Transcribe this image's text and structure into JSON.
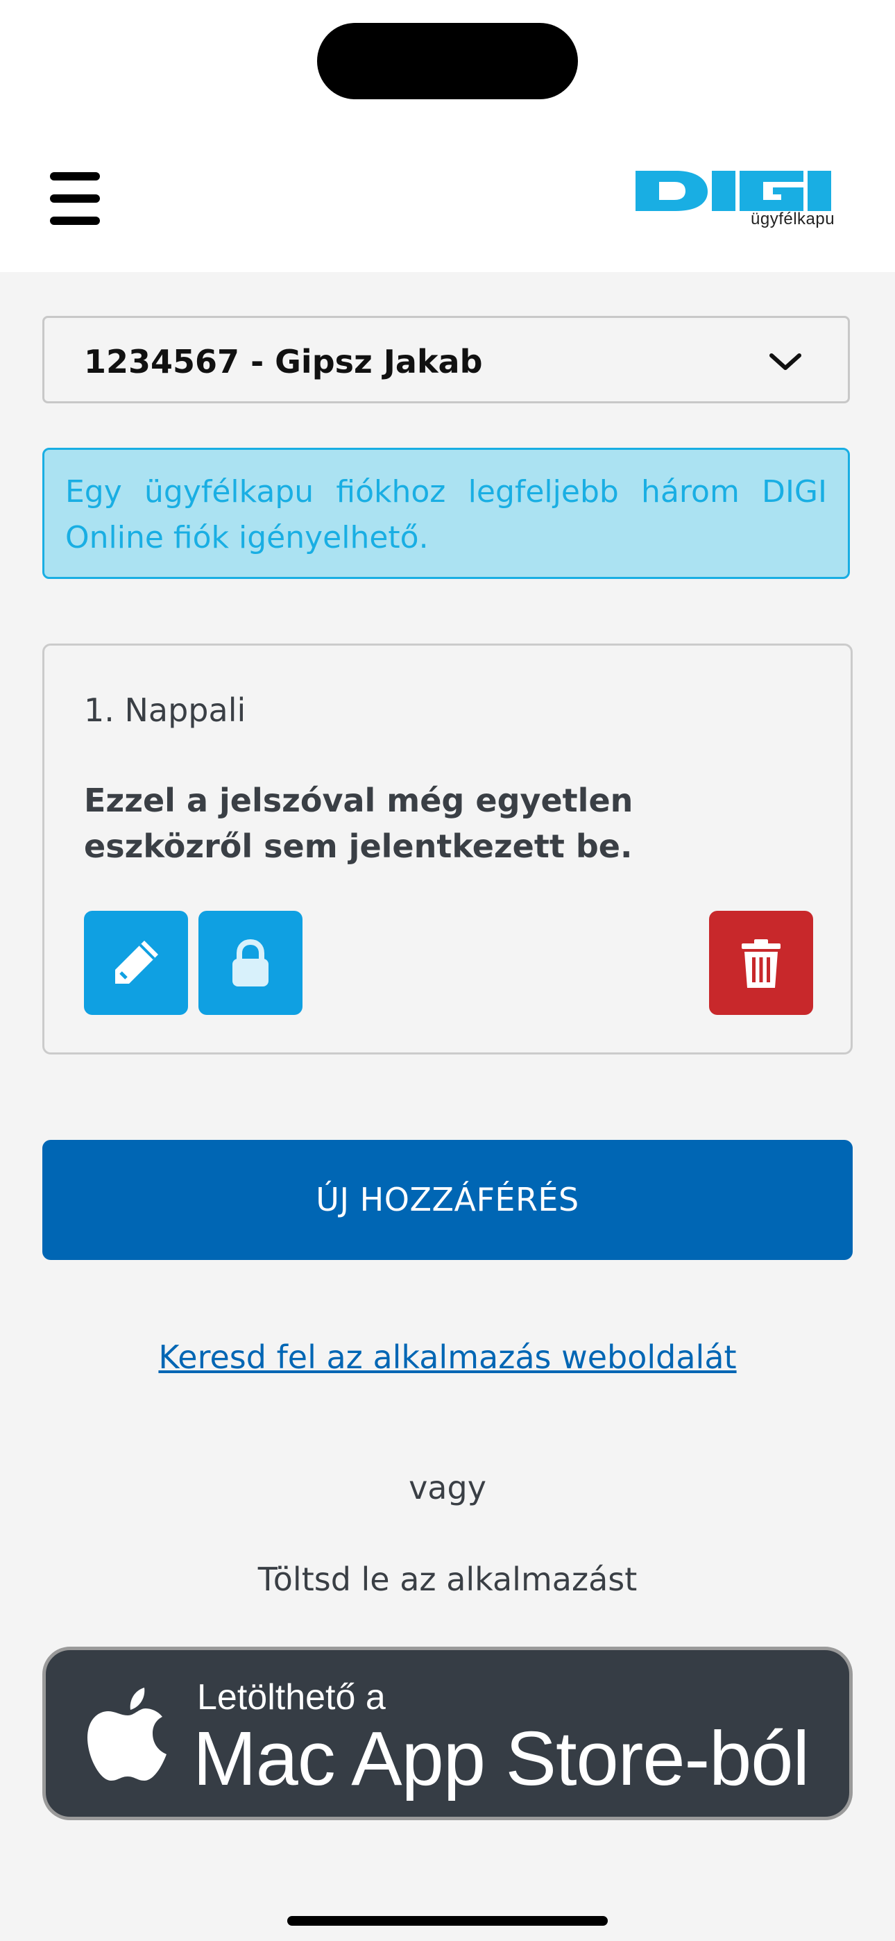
{
  "header": {
    "logo_text": "DIGI",
    "logo_subtitle": "ügyfélkapu",
    "brand_color": "#19aee3"
  },
  "account_select": {
    "selected_value": "1234567 - Gipsz Jakab"
  },
  "info_message": "Egy ügyfélkapu fiókhoz legfeljebb három DIGI Online fiók igényelhető.",
  "device_card": {
    "title": "1. Nappali",
    "description": "Ezzel a jelszóval még egyetlen eszközről sem jelentkezett be.",
    "icons": [
      "pencil-icon",
      "lock-icon",
      "trash-icon"
    ]
  },
  "new_access_button": "ÚJ HOZZÁFÉRÉS",
  "website_link": "Keresd fel az alkalmazás weboldalát",
  "or_text": "vagy",
  "download_text": "Töltsd le az alkalmazást",
  "store_badge": {
    "small_text": "Letölthető a",
    "big_text": "Mac App Store-ból"
  },
  "colors": {
    "primary": "#0066b4",
    "accent": "#0fa0e2",
    "danger": "#c8282b",
    "info_bg": "#abe2f2"
  }
}
